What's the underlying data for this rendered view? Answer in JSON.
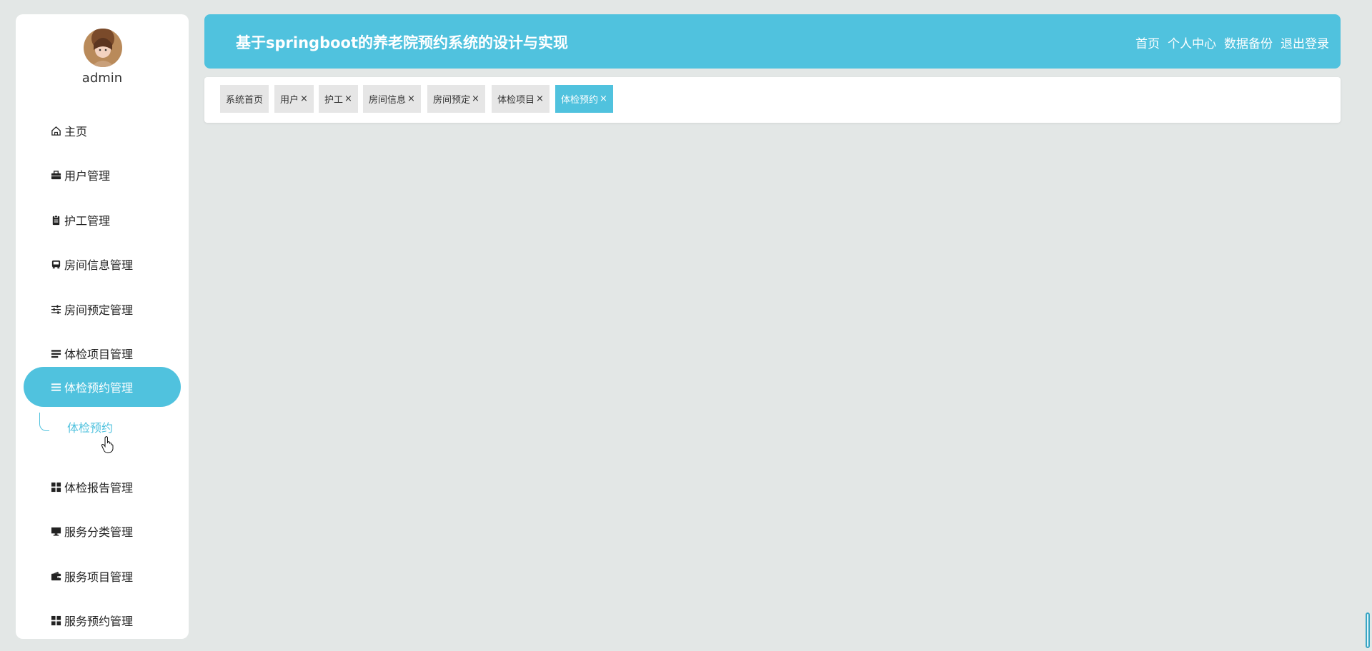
{
  "user": {
    "name": "admin"
  },
  "sidebar": {
    "items": [
      {
        "label": "主页",
        "icon": "home-icon"
      },
      {
        "label": "用户管理",
        "icon": "briefcase-icon"
      },
      {
        "label": "护工管理",
        "icon": "clipboard-icon"
      },
      {
        "label": "房间信息管理",
        "icon": "bus-icon"
      },
      {
        "label": "房间预定管理",
        "icon": "sliders-icon"
      },
      {
        "label": "体检项目管理",
        "icon": "list-icon"
      },
      {
        "label": "体检预约管理",
        "icon": "list-icon",
        "active": true
      },
      {
        "label": "体检报告管理",
        "icon": "grid-icon"
      },
      {
        "label": "服务分类管理",
        "icon": "monitor-icon"
      },
      {
        "label": "服务项目管理",
        "icon": "wallet-icon"
      },
      {
        "label": "服务预约管理",
        "icon": "grid-icon"
      }
    ],
    "submenu": {
      "label": "体检预约"
    }
  },
  "header": {
    "title": "基于springboot的养老院预约系统的设计与实现",
    "nav": [
      "首页",
      "个人中心",
      "数据备份",
      "退出登录"
    ]
  },
  "tabs": [
    {
      "label": "系统首页",
      "closable": false
    },
    {
      "label": "用户",
      "closable": true
    },
    {
      "label": "护工",
      "closable": true
    },
    {
      "label": "房间信息",
      "closable": true
    },
    {
      "label": "房间预定",
      "closable": true
    },
    {
      "label": "体检项目",
      "closable": true
    },
    {
      "label": "体检预约",
      "closable": true,
      "active": true
    }
  ],
  "colors": {
    "accent": "#50c2de",
    "background": "#e3e7e6",
    "tab_inactive": "#e6e6e6"
  }
}
